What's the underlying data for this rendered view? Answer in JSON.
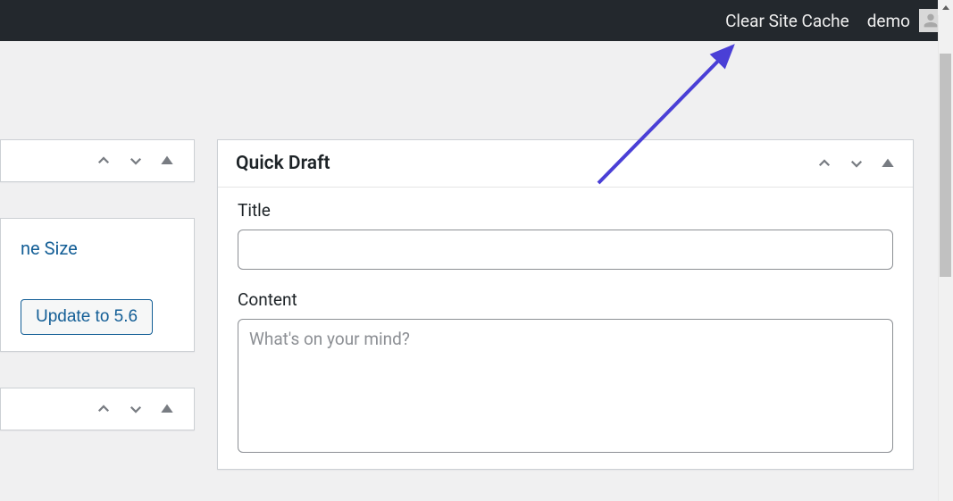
{
  "adminbar": {
    "clear_cache_label": "Clear Site Cache",
    "username": "demo"
  },
  "left_widget_middle": {
    "link_text": "ne Size",
    "update_button_label": "Update to 5.6"
  },
  "quick_draft": {
    "title": "Quick Draft",
    "title_label": "Title",
    "title_value": "",
    "content_label": "Content",
    "content_placeholder": "What's on your mind?",
    "content_value": ""
  },
  "icons": {
    "chevron_up": "chevron-up-icon",
    "chevron_down": "chevron-down-icon",
    "collapse": "collapse-icon"
  }
}
